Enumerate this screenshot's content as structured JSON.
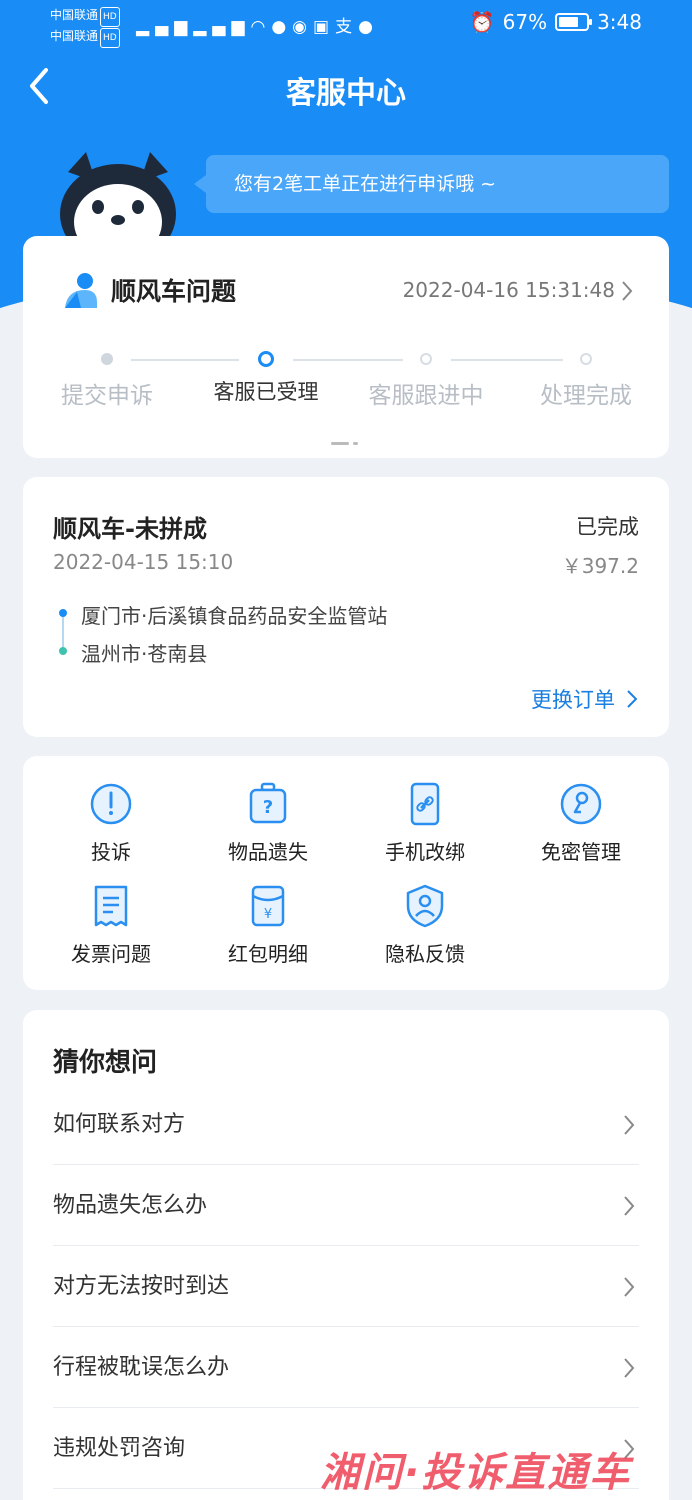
{
  "status_bar": {
    "carrier_1": "中国联通",
    "carrier_2": "中国联通",
    "hd": "HD",
    "battery": "67%",
    "time": "3:48"
  },
  "header": {
    "title": "客服中心"
  },
  "bubble": {
    "text": "您有2笔工单正在进行申诉哦 ~"
  },
  "complaint": {
    "category": "顺风车问题",
    "time": "2022-04-16 15:31:48",
    "steps": [
      {
        "label": "提交申诉",
        "state": "done"
      },
      {
        "label": "客服已受理",
        "state": "current"
      },
      {
        "label": "客服跟进中",
        "state": "todo"
      },
      {
        "label": "处理完成",
        "state": "todo"
      }
    ]
  },
  "order": {
    "title": "顺风车-未拼成",
    "status": "已完成",
    "date": "2022-04-15 15:10",
    "price": "￥397.2",
    "from": "厦门市·后溪镇食品药品安全监管站",
    "to": "温州市·苍南县",
    "change_label": "更换订单"
  },
  "services": [
    {
      "label": "投诉",
      "icon": "exclamation-icon"
    },
    {
      "label": "物品遗失",
      "icon": "suitcase-question-icon"
    },
    {
      "label": "手机改绑",
      "icon": "phone-link-icon"
    },
    {
      "label": "免密管理",
      "icon": "key-icon"
    },
    {
      "label": "发票问题",
      "icon": "invoice-icon"
    },
    {
      "label": "红包明细",
      "icon": "red-envelope-icon"
    },
    {
      "label": "隐私反馈",
      "icon": "privacy-shield-icon"
    }
  ],
  "faq": {
    "title": "猜你想问",
    "items": [
      "如何联系对方",
      "物品遗失怎么办",
      "对方无法按时到达",
      "行程被耽误怎么办",
      "违规处罚咨询"
    ]
  },
  "watermark": "湘问·投诉直通车",
  "colors": {
    "primary": "#1a8cf5",
    "bubble": "#4aa6f8",
    "link": "#1a7fe0"
  }
}
